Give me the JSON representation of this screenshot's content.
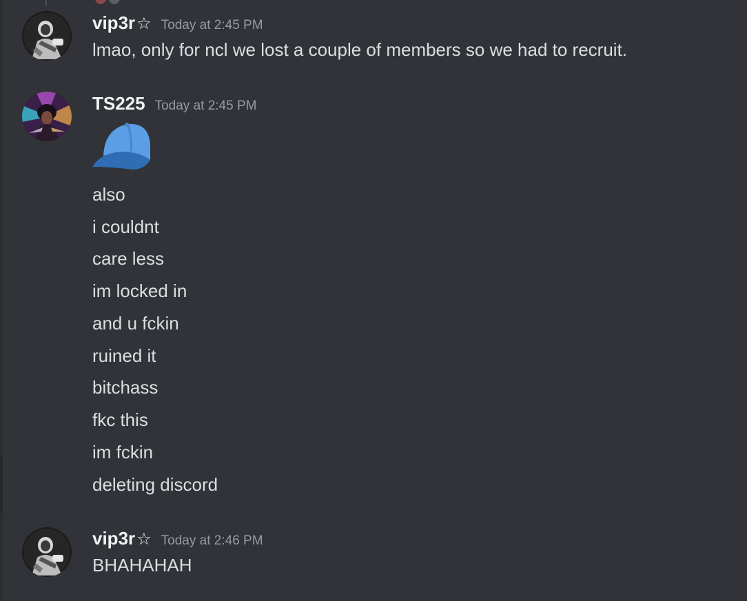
{
  "colors": {
    "background": "#313338",
    "username": "#f2f3f5",
    "timestamp": "#949ba4",
    "message_text": "#dbdee1"
  },
  "messages": [
    {
      "author": "vip3r",
      "author_badge": "☆",
      "timestamp": "Today at 2:45 PM",
      "lines": [
        "lmao, only for ncl we lost a couple of members so we had to recruit."
      ]
    },
    {
      "author": "TS225",
      "timestamp": "Today at 2:45 PM",
      "emoji": "blue-cap-emoji",
      "lines": [
        "also",
        "i couldnt",
        "care less",
        "im locked in",
        "and u fckin",
        "ruined it",
        "bitchass",
        "fkc this",
        "im fckin",
        "deleting discord"
      ]
    },
    {
      "author": "vip3r",
      "author_badge": "☆",
      "timestamp": "Today at 2:46 PM",
      "lines": [
        "BHAHAHAH"
      ]
    }
  ]
}
